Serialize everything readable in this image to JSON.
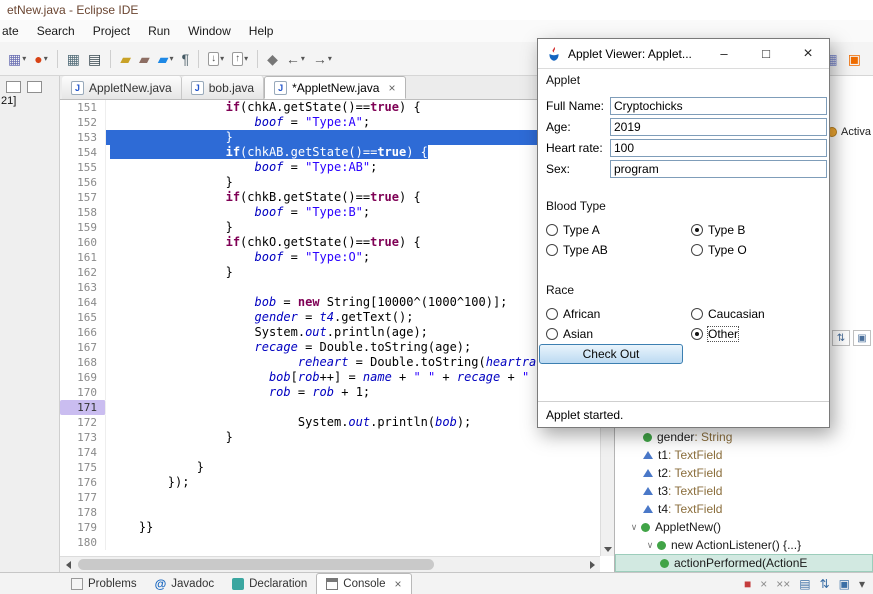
{
  "colors": {
    "selection_blue": "#2e6bd6",
    "keyword": "#7f0055",
    "string_literal": "#2a00ff",
    "field_ref": "#0000c0",
    "outline_type": "#8a6d3b"
  },
  "titlebar": {
    "title": "etNew.java - Eclipse IDE"
  },
  "menubar": {
    "items": [
      "ate",
      "Search",
      "Project",
      "Run",
      "Window",
      "Help"
    ]
  },
  "toolbar": {
    "dropdown_glyph": "▾",
    "icons": [
      {
        "name": "new-wizard",
        "glyph": "▦",
        "color": "#6a6fb3",
        "dd": true
      },
      {
        "name": "run-config",
        "glyph": "●",
        "color": "#d84315",
        "dd": true
      },
      {
        "sep": true
      },
      {
        "name": "open-type",
        "glyph": "▦",
        "color": "#546e7a"
      },
      {
        "name": "print",
        "glyph": "▤",
        "color": "#37474f"
      },
      {
        "sep": true
      },
      {
        "name": "new-folder",
        "glyph": "▰",
        "color": "#c9a227"
      },
      {
        "name": "open-resource",
        "glyph": "▰",
        "color": "#8d6e63"
      },
      {
        "name": "format",
        "glyph": "▰",
        "color": "#1e88e5",
        "dd": true
      },
      {
        "name": "show-whitespace",
        "glyph": "¶",
        "color": "#455a64"
      },
      {
        "sep": true
      },
      {
        "name": "next-annotation",
        "glyph": "↓",
        "color": "#555555",
        "box": true,
        "dd": true
      },
      {
        "name": "prev-annotation",
        "glyph": "↑",
        "color": "#555555",
        "box": true,
        "dd": true
      },
      {
        "sep": true
      },
      {
        "name": "last-edit-location",
        "glyph": "◆",
        "color": "#777777"
      },
      {
        "name": "back",
        "glyph": "←",
        "color": "#555555",
        "dd": true
      },
      {
        "name": "forward",
        "glyph": "→",
        "color": "#555555",
        "dd": true
      }
    ],
    "right_icons": [
      {
        "name": "open-perspective",
        "glyph": "▦",
        "color": "#7986cb"
      },
      {
        "name": "java-perspective",
        "glyph": "▣",
        "color": "#ef6c00"
      }
    ]
  },
  "left_rail": {
    "badge": "21]"
  },
  "editor_tabs": {
    "close_glyph": "×",
    "java_icon_glyph": "J",
    "tabs": [
      {
        "label": "AppletNew.java"
      },
      {
        "label": "bob.java"
      },
      {
        "label": "*AppletNew.java",
        "active": true
      }
    ]
  },
  "editor": {
    "lines": [
      {
        "n": 151,
        "i": 16,
        "s": [
          [
            "kw",
            "if"
          ],
          [
            "pl",
            "(chkA.getState()=="
          ],
          [
            "kw",
            "true"
          ],
          [
            "pl",
            ") {"
          ]
        ]
      },
      {
        "n": 152,
        "i": 20,
        "s": [
          [
            "fl",
            "boof"
          ],
          [
            "pl",
            " = "
          ],
          [
            "st",
            "\"Type:A\""
          ],
          [
            "pl",
            ";"
          ]
        ]
      },
      {
        "n": 153,
        "i": 16,
        "hl": "full",
        "s": [
          [
            "pl",
            "}"
          ]
        ]
      },
      {
        "n": 154,
        "i": 16,
        "hl": "text",
        "s": [
          [
            "kw",
            "if"
          ],
          [
            "pl",
            "(chkAB.getState()=="
          ],
          [
            "kw",
            "true"
          ],
          [
            "pl",
            ") {"
          ]
        ]
      },
      {
        "n": 155,
        "i": 20,
        "s": [
          [
            "fl",
            "boof"
          ],
          [
            "pl",
            " = "
          ],
          [
            "st",
            "\"Type:AB\""
          ],
          [
            "pl",
            ";"
          ]
        ]
      },
      {
        "n": 156,
        "i": 16,
        "s": [
          [
            "pl",
            "}"
          ]
        ]
      },
      {
        "n": 157,
        "i": 16,
        "s": [
          [
            "kw",
            "if"
          ],
          [
            "pl",
            "(chkB.getState()=="
          ],
          [
            "kw",
            "true"
          ],
          [
            "pl",
            ") {"
          ]
        ]
      },
      {
        "n": 158,
        "i": 20,
        "s": [
          [
            "fl",
            "boof"
          ],
          [
            "pl",
            " = "
          ],
          [
            "st",
            "\"Type:B\""
          ],
          [
            "pl",
            ";"
          ]
        ]
      },
      {
        "n": 159,
        "i": 16,
        "s": [
          [
            "pl",
            "}"
          ]
        ]
      },
      {
        "n": 160,
        "i": 16,
        "s": [
          [
            "kw",
            "if"
          ],
          [
            "pl",
            "(chkO.getState()=="
          ],
          [
            "kw",
            "true"
          ],
          [
            "pl",
            ") {"
          ]
        ]
      },
      {
        "n": 161,
        "i": 20,
        "s": [
          [
            "fl",
            "boof"
          ],
          [
            "pl",
            " = "
          ],
          [
            "st",
            "\"Type:O\""
          ],
          [
            "pl",
            ";"
          ]
        ]
      },
      {
        "n": 162,
        "i": 16,
        "s": [
          [
            "pl",
            "}"
          ]
        ]
      },
      {
        "n": 163,
        "i": 0,
        "s": []
      },
      {
        "n": 164,
        "i": 20,
        "s": [
          [
            "fl",
            "bob"
          ],
          [
            "pl",
            " = "
          ],
          [
            "kw",
            "new"
          ],
          [
            "pl",
            " String[10000^(1000^100)];"
          ]
        ]
      },
      {
        "n": 165,
        "i": 20,
        "s": [
          [
            "fl",
            "gender"
          ],
          [
            "pl",
            " = "
          ],
          [
            "fl",
            "t4"
          ],
          [
            "pl",
            ".getText();"
          ]
        ]
      },
      {
        "n": 166,
        "i": 20,
        "s": [
          [
            "pl",
            "System."
          ],
          [
            "fl",
            "out"
          ],
          [
            "pl",
            ".println(age);"
          ]
        ]
      },
      {
        "n": 167,
        "i": 20,
        "s": [
          [
            "fl",
            "recage"
          ],
          [
            "pl",
            " = Double.toString(age);"
          ]
        ]
      },
      {
        "n": 168,
        "i": 26,
        "s": [
          [
            "fl",
            "reheart"
          ],
          [
            "pl",
            " = Double.toString("
          ],
          [
            "fl",
            "heartra"
          ]
        ]
      },
      {
        "n": 169,
        "i": 22,
        "s": [
          [
            "fl",
            "bob"
          ],
          [
            "pl",
            "["
          ],
          [
            "fl",
            "rob"
          ],
          [
            "pl",
            "++] = "
          ],
          [
            "fl",
            "name"
          ],
          [
            "pl",
            " + "
          ],
          [
            "st",
            "\" \""
          ],
          [
            "pl",
            " + "
          ],
          [
            "fl",
            "recage"
          ],
          [
            "pl",
            " + "
          ],
          [
            "st",
            "\""
          ]
        ]
      },
      {
        "n": 170,
        "i": 22,
        "s": [
          [
            "fl",
            "rob"
          ],
          [
            "pl",
            " = "
          ],
          [
            "fl",
            "rob"
          ],
          [
            "pl",
            " + 1;"
          ]
        ]
      },
      {
        "n": 171,
        "i": 0,
        "mark": true,
        "s": []
      },
      {
        "n": 172,
        "i": 26,
        "s": [
          [
            "pl",
            "System."
          ],
          [
            "fl",
            "out"
          ],
          [
            "pl",
            ".println("
          ],
          [
            "fl",
            "bob"
          ],
          [
            "pl",
            ");"
          ]
        ]
      },
      {
        "n": 173,
        "i": 16,
        "s": [
          [
            "pl",
            "}"
          ]
        ]
      },
      {
        "n": 174,
        "i": 0,
        "s": []
      },
      {
        "n": 175,
        "i": 12,
        "s": [
          [
            "pl",
            "}"
          ]
        ]
      },
      {
        "n": 176,
        "i": 8,
        "s": [
          [
            "pl",
            "});"
          ]
        ]
      },
      {
        "n": 177,
        "i": 0,
        "s": []
      },
      {
        "n": 178,
        "i": 0,
        "s": []
      },
      {
        "n": 179,
        "i": 4,
        "s": [
          [
            "pl",
            "}}"
          ]
        ]
      },
      {
        "n": 180,
        "i": 0,
        "s": []
      }
    ]
  },
  "applet_window": {
    "title": "Applet Viewer: Applet...",
    "controls": {
      "minimize": "–",
      "maximize": "□",
      "close": "×"
    },
    "menu_label": "Applet",
    "fields": [
      {
        "label": "Full Name:",
        "value": "Cryptochicks"
      },
      {
        "label": "Age:",
        "value": "2019"
      },
      {
        "label": "Heart rate:",
        "value": "100"
      },
      {
        "label": "Sex:",
        "value": "program"
      }
    ],
    "blood_type": {
      "label": "Blood Type",
      "options": [
        {
          "label": "Type A"
        },
        {
          "label": "Type B",
          "selected": true
        },
        {
          "label": "Type AB"
        },
        {
          "label": "Type O"
        }
      ]
    },
    "race": {
      "label": "Race",
      "options": [
        {
          "label": "African"
        },
        {
          "label": "Caucasian"
        },
        {
          "label": "Asian"
        },
        {
          "label": "Other",
          "selected": true,
          "focused": true
        }
      ]
    },
    "button_label": "Check Out",
    "status": "Applet started."
  },
  "outline": {
    "activate_label": "Activa",
    "chevron_glyph": "∨",
    "toolbar_icons": [
      {
        "name": "sort",
        "glyph": "⇅"
      },
      {
        "name": "filter-fields",
        "glyph": "▣"
      }
    ],
    "items": [
      {
        "indent": 1,
        "icon": "field-public",
        "name": "gender",
        "type": "String"
      },
      {
        "indent": 1,
        "icon": "field-default",
        "name": "t1",
        "type": "TextField"
      },
      {
        "indent": 1,
        "icon": "field-default",
        "name": "t2",
        "type": "TextField"
      },
      {
        "indent": 1,
        "icon": "field-default",
        "name": "t3",
        "type": "TextField"
      },
      {
        "indent": 1,
        "icon": "field-default",
        "name": "t4",
        "type": "TextField"
      },
      {
        "indent": 0,
        "chev": true,
        "icon": "constructor",
        "name": "AppletNew()"
      },
      {
        "indent": 1,
        "chev": true,
        "icon": "anonymous-class",
        "name": "new ActionListener() {...}"
      },
      {
        "indent": 2,
        "icon": "method-public",
        "name": "actionPerformed(ActionE",
        "selected": true
      }
    ]
  },
  "console_area": {
    "close_glyph": "×",
    "tabs": [
      {
        "label": "Problems",
        "icon": "problems"
      },
      {
        "label": "Javadoc",
        "icon": "javadoc",
        "glyph": "@"
      },
      {
        "label": "Declaration",
        "icon": "declaration"
      },
      {
        "label": "Console",
        "icon": "console",
        "active": true
      }
    ],
    "actions": [
      {
        "name": "terminate",
        "glyph": "■",
        "color": "#c43c3c"
      },
      {
        "name": "remove-launch",
        "glyph": "×",
        "color": "#8a8a8a"
      },
      {
        "name": "remove-all-launches",
        "glyph": "××",
        "color": "#8a8a8a"
      },
      {
        "name": "clear-console",
        "glyph": "▤",
        "color": "#3a6ea5"
      },
      {
        "name": "scroll-lock",
        "glyph": "⇅",
        "color": "#3a6ea5"
      },
      {
        "name": "pin-console",
        "glyph": "▣",
        "color": "#3a6ea5"
      },
      {
        "name": "display-selected-console",
        "glyph": "▾",
        "color": "#555555"
      }
    ]
  }
}
